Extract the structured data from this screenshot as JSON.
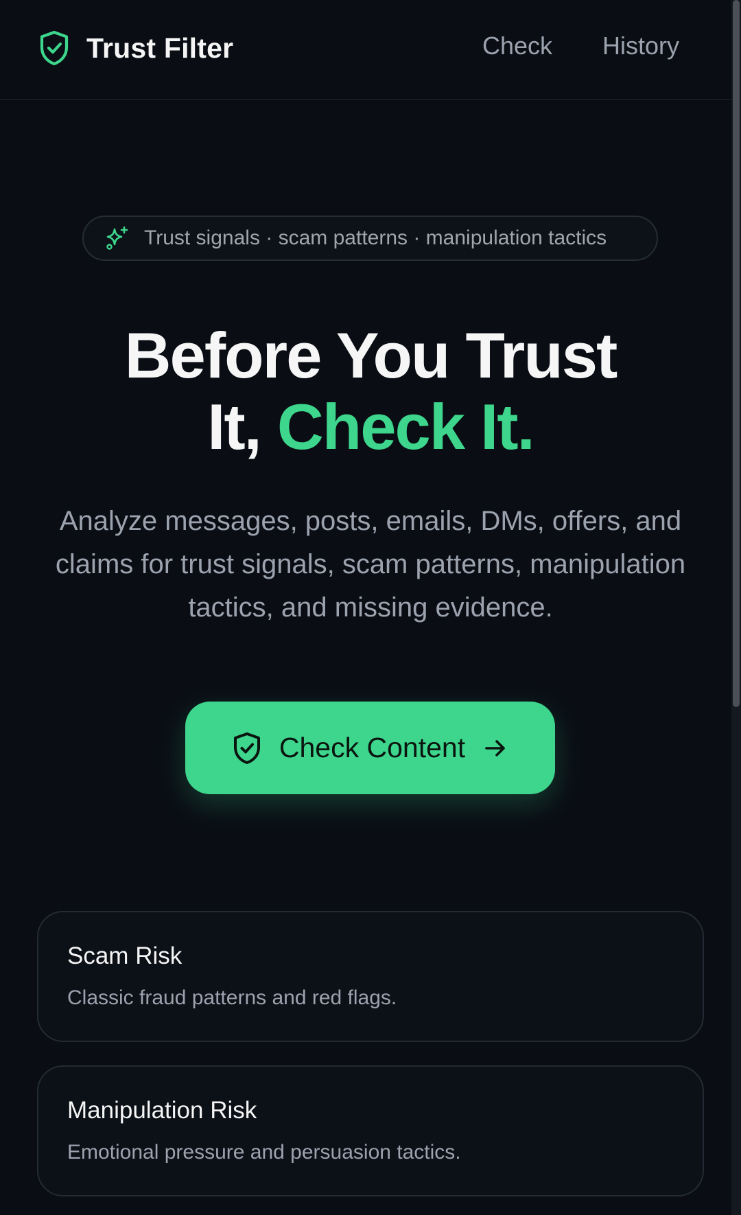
{
  "colors": {
    "background": "#0a0e14",
    "accent": "#3dd68c",
    "text_primary": "#f5f5f5",
    "text_muted": "#9ca3af",
    "border": "#242a34"
  },
  "header": {
    "brand_icon": "shield-check-icon",
    "brand_name": "Trust Filter",
    "nav": [
      {
        "label": "Check"
      },
      {
        "label": "History"
      }
    ]
  },
  "hero": {
    "pill_icon": "sparkles-icon",
    "pill_text": "Trust signals · scam patterns · manipulation tactics",
    "heading_line1": "Before You Trust",
    "heading_line2_prefix": "It, ",
    "heading_line2_accent": "Check It.",
    "subtitle": "Analyze messages, posts, emails, DMs, offers, and claims for trust signals, scam patterns, manipulation tactics, and missing evidence.",
    "cta": {
      "icon": "shield-check-icon",
      "label": "Check Content",
      "arrow_icon": "arrow-right-icon"
    }
  },
  "cards": [
    {
      "title": "Scam Risk",
      "description": "Classic fraud patterns and red flags."
    },
    {
      "title": "Manipulation Risk",
      "description": "Emotional pressure and persuasion tactics."
    }
  ]
}
